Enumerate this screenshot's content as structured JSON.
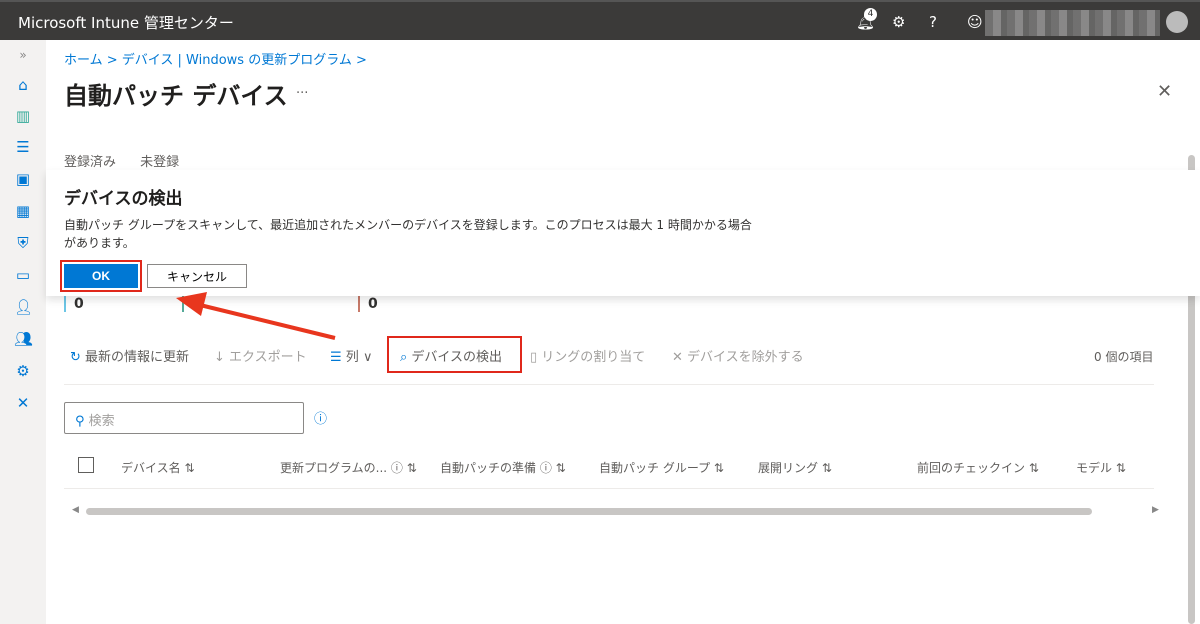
{
  "header": {
    "title": "Microsoft Intune 管理センター",
    "notification_count": "4"
  },
  "breadcrumb": [
    "ホーム",
    "デバイス | Windows の更新プログラム"
  ],
  "page": {
    "title": "自動パッチ デバイス",
    "more": "...",
    "close": "✕"
  },
  "tabs": [
    "登録済み",
    "未登録"
  ],
  "dialog": {
    "title": "デバイスの検出",
    "message": "自動パッチ グループをスキャンして、最近追加されたメンバーのデバイスを登録します。このプロセスは最大 1 時間かかる場合があります。",
    "ok": "OK",
    "cancel": "キャンセル"
  },
  "stats": [
    "0",
    "0"
  ],
  "toolbar": {
    "refresh": "最新の情報に更新",
    "export": "エクスポート",
    "columns": "列",
    "discover": "デバイスの検出",
    "assign_ring": "リングの割り当て",
    "remove": "デバイスを除外する",
    "count": "0 個の項目"
  },
  "search": {
    "placeholder": "検索"
  },
  "columns": [
    "デバイス名",
    "更新プログラムの...",
    "自動パッチの準備",
    "自動パッチ グループ",
    "展開リング",
    "前回のチェックイン",
    "モデル"
  ]
}
